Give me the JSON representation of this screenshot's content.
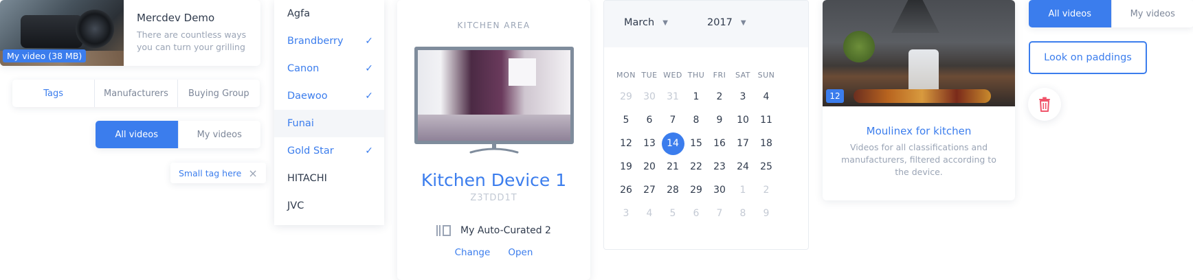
{
  "video_card": {
    "badge": "My video (38 MB)",
    "title": "Mercdev Demo",
    "description": "There are countless ways you can turn your grilling"
  },
  "tags_tabs": [
    {
      "label": "Tags",
      "active": true
    },
    {
      "label": "Manufacturers",
      "active": false
    },
    {
      "label": "Buying Group",
      "active": false
    }
  ],
  "video_tabs": [
    {
      "label": "All videos",
      "active": true
    },
    {
      "label": "My videos",
      "active": false
    }
  ],
  "small_tag": {
    "label": "Small tag here",
    "close": "×"
  },
  "brands": [
    {
      "label": "Agfa",
      "selected": false,
      "highlighted": false
    },
    {
      "label": "Brandberry",
      "selected": true,
      "highlighted": false
    },
    {
      "label": "Canon",
      "selected": true,
      "highlighted": false
    },
    {
      "label": "Daewoo",
      "selected": true,
      "highlighted": false
    },
    {
      "label": "Funai",
      "selected": true,
      "highlighted": true,
      "checked": false
    },
    {
      "label": "Gold Star",
      "selected": true,
      "highlighted": false
    },
    {
      "label": "HITACHI",
      "selected": false,
      "highlighted": false
    },
    {
      "label": "JVC",
      "selected": false,
      "highlighted": false
    }
  ],
  "device": {
    "area": "KITCHEN AREA",
    "name": "Kitchen Device 1",
    "code": "Z3TDD1T",
    "curated": "My Auto-Curated 2",
    "change": "Change",
    "open": "Open"
  },
  "calendar": {
    "month": "March",
    "year": "2017",
    "weekdays": [
      "MON",
      "TUE",
      "WED",
      "THU",
      "FRI",
      "SAT",
      "SUN"
    ],
    "weeks": [
      [
        "29",
        "30",
        "31",
        "1",
        "2",
        "3",
        "4"
      ],
      [
        "5",
        "6",
        "7",
        "8",
        "9",
        "10",
        "11"
      ],
      [
        "12",
        "13",
        "14",
        "15",
        "16",
        "17",
        "18"
      ],
      [
        "19",
        "20",
        "21",
        "22",
        "23",
        "24",
        "25"
      ],
      [
        "26",
        "27",
        "28",
        "29",
        "30",
        "1",
        "2"
      ],
      [
        "3",
        "4",
        "5",
        "6",
        "7",
        "8",
        "9"
      ]
    ],
    "today": "14"
  },
  "moulinex": {
    "badge": "12",
    "title": "Moulinex for kitchen",
    "description": "Videos for all classifications and manufacturers, filtered according to the device."
  },
  "look_paddings": "Look on paddings",
  "icons": {
    "trash": "trash-icon",
    "check": "check-icon",
    "close": "close-icon",
    "chevron": "triangle-down-icon",
    "playlist": "playlist-icon"
  },
  "colors": {
    "accent": "#3b7ded",
    "danger": "#f0546a",
    "muted_text": "#9aa4b5"
  }
}
